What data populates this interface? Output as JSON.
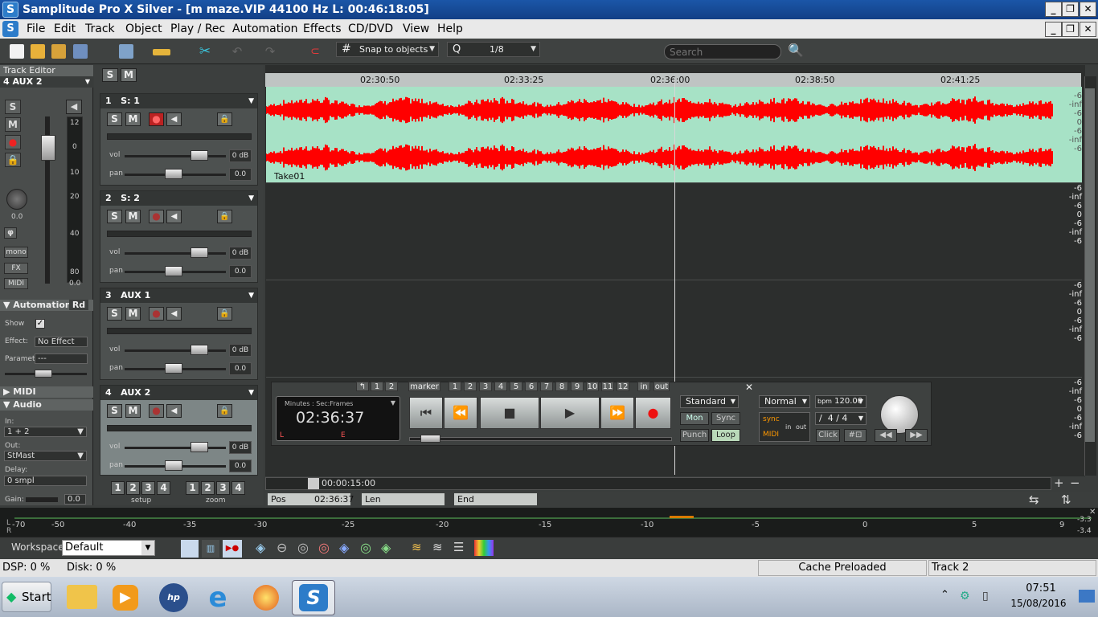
{
  "title_bar": {
    "text": "Samplitude Pro X Silver - [m maze.VIP   44100 Hz L: 00:46:18:05]"
  },
  "menu": [
    "File",
    "Edit",
    "Track",
    "Object",
    "Play / Rec",
    "Automation",
    "Effects",
    "CD/DVD",
    "View",
    "Help"
  ],
  "toolbar": {
    "snap_label": "Snap to objects",
    "zoom_value": "1/8",
    "search_placeholder": "Search"
  },
  "track_editor": {
    "header": "Track Editor",
    "current_track": "4   AUX 2",
    "solo": "S",
    "mute": "M",
    "knob_value": "0.0",
    "fader_value": "0.0",
    "meter_ticks": [
      "12",
      "0",
      "10",
      "20",
      "40",
      "80"
    ],
    "phase": "φ",
    "mono": "mono",
    "fx": "FX",
    "midi": "MIDI"
  },
  "automation": {
    "header": "Automation",
    "mode": "Rd",
    "show_label": "Show",
    "effect_label": "Effect:",
    "effect_value": "No Effect",
    "parameter_label": "Parameter:",
    "parameter_value": "---"
  },
  "midi_section": "MIDI",
  "audio": {
    "header": "Audio",
    "in_label": "In:",
    "in_value": "1 + 2",
    "out_label": "Out:",
    "out_value": "StMast",
    "delay_label": "Delay:",
    "delay_value": "0 smpl",
    "gain_label": "Gain:",
    "gain_value": "0.0"
  },
  "global_sm": {
    "solo": "S",
    "mute": "M"
  },
  "tracks": [
    {
      "num": "1",
      "name": "S: 1",
      "vol_label": "vol",
      "vol": "0 dB",
      "pan_label": "pan",
      "pan": "0.0",
      "armed": true
    },
    {
      "num": "2",
      "name": "S: 2",
      "vol_label": "vol",
      "vol": "0 dB",
      "pan_label": "pan",
      "pan": "0.0",
      "armed": false
    },
    {
      "num": "3",
      "name": "AUX 1",
      "vol_label": "vol",
      "vol": "0 dB",
      "pan_label": "pan",
      "pan": "0.0",
      "armed": false
    },
    {
      "num": "4",
      "name": "AUX 2",
      "vol_label": "vol",
      "vol": "0 dB",
      "pan_label": "pan",
      "pan": "0.0",
      "armed": false
    }
  ],
  "setup_zoom": {
    "setup_label": "setup",
    "zoom_label": "zoom",
    "setup_buttons": [
      "1",
      "2",
      "3",
      "4"
    ],
    "zoom_buttons": [
      "1",
      "2",
      "3",
      "4"
    ]
  },
  "ruler": {
    "ticks": [
      "02:30:50",
      "02:33:25",
      "02:36:00",
      "02:38:50",
      "02:41:25"
    ]
  },
  "object": {
    "name": "Take01"
  },
  "db_scale": [
    "-6",
    "-inf",
    "-6",
    "0",
    "-6",
    "-inf",
    "-6"
  ],
  "marker_bar": {
    "label": "marker",
    "numbers": [
      "1",
      "2",
      "3",
      "4",
      "5",
      "6",
      "7",
      "8",
      "9",
      "10",
      "11",
      "12"
    ],
    "left_nums": [
      "1",
      "2"
    ],
    "in_label": "in",
    "out_label": "out"
  },
  "transport": {
    "time_format": "Minutes : Sec:Frames",
    "time": "02:36:37",
    "l_marker": "L",
    "e_marker": "E",
    "mode": "Standard",
    "mon": "Mon",
    "sync": "Sync",
    "punch": "Punch",
    "loop": "Loop",
    "tempo_mode": "Normal",
    "bpm_label": "bpm",
    "bpm": "120.00",
    "sig_prefix": "/",
    "signature": "4 / 4",
    "sync_label": "sync",
    "midi_label": "MIDI",
    "in_label": "in",
    "out_label": "out",
    "click": "Click"
  },
  "position_bar": {
    "duration": "00:00:15:00",
    "pos_label": "Pos",
    "pos": "02:36:37",
    "len_label": "Len",
    "end_label": "End"
  },
  "master_meter": {
    "ticks": [
      "-70",
      "-50",
      "-40",
      "-35",
      "-30",
      "-25",
      "-20",
      "-15",
      "-10",
      "-5",
      "0",
      "5",
      "9"
    ],
    "peak": "-3.3",
    "peak2": "-3.4"
  },
  "workspace": {
    "label": "Workspace:",
    "value": "Default"
  },
  "status": {
    "dsp": "DSP:  0 %",
    "disk": "Disk:   0 %",
    "cache": "Cache Preloaded",
    "track": "Track 2"
  },
  "taskbar": {
    "start": "Start",
    "time": "07:51",
    "date": "15/08/2016"
  },
  "colors": {
    "waveform": "#ff0000",
    "lane_bg": "#a7e2c6",
    "title_bar": "#1b56a8"
  }
}
